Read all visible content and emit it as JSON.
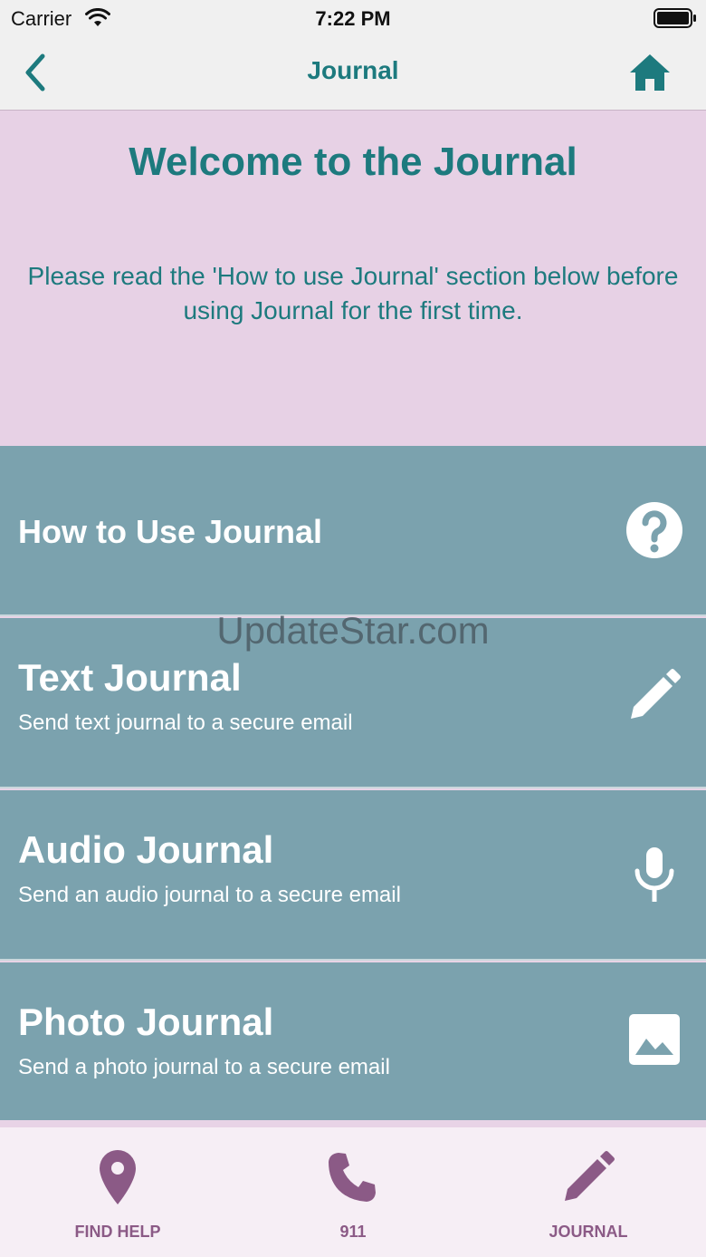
{
  "status_bar": {
    "carrier": "Carrier",
    "time": "7:22 PM"
  },
  "nav": {
    "title": "Journal"
  },
  "welcome": {
    "title": "Welcome to the Journal",
    "text": "Please read the 'How to use Journal' section below before using Journal for the first time."
  },
  "menu": {
    "items": [
      {
        "title": "How to Use Journal",
        "subtitle": "",
        "icon": "question-circle-icon"
      },
      {
        "title": "Text Journal",
        "subtitle": "Send text journal to a secure email",
        "icon": "pencil-icon"
      },
      {
        "title": "Audio Journal",
        "subtitle": "Send an audio journal to a secure email",
        "icon": "microphone-icon"
      },
      {
        "title": "Photo Journal",
        "subtitle": "Send a photo journal to a secure email",
        "icon": "image-icon"
      }
    ]
  },
  "watermark": "UpdateStar.com",
  "tabs": [
    {
      "label": "FIND HELP",
      "icon": "map-pin-icon"
    },
    {
      "label": "911",
      "icon": "phone-icon"
    },
    {
      "label": "JOURNAL",
      "icon": "pencil-icon"
    }
  ],
  "colors": {
    "teal": "#1d7a7e",
    "menu_bg": "#7ba2ae",
    "welcome_bg": "#e7d1e5",
    "tab_accent": "#8b5a86"
  }
}
